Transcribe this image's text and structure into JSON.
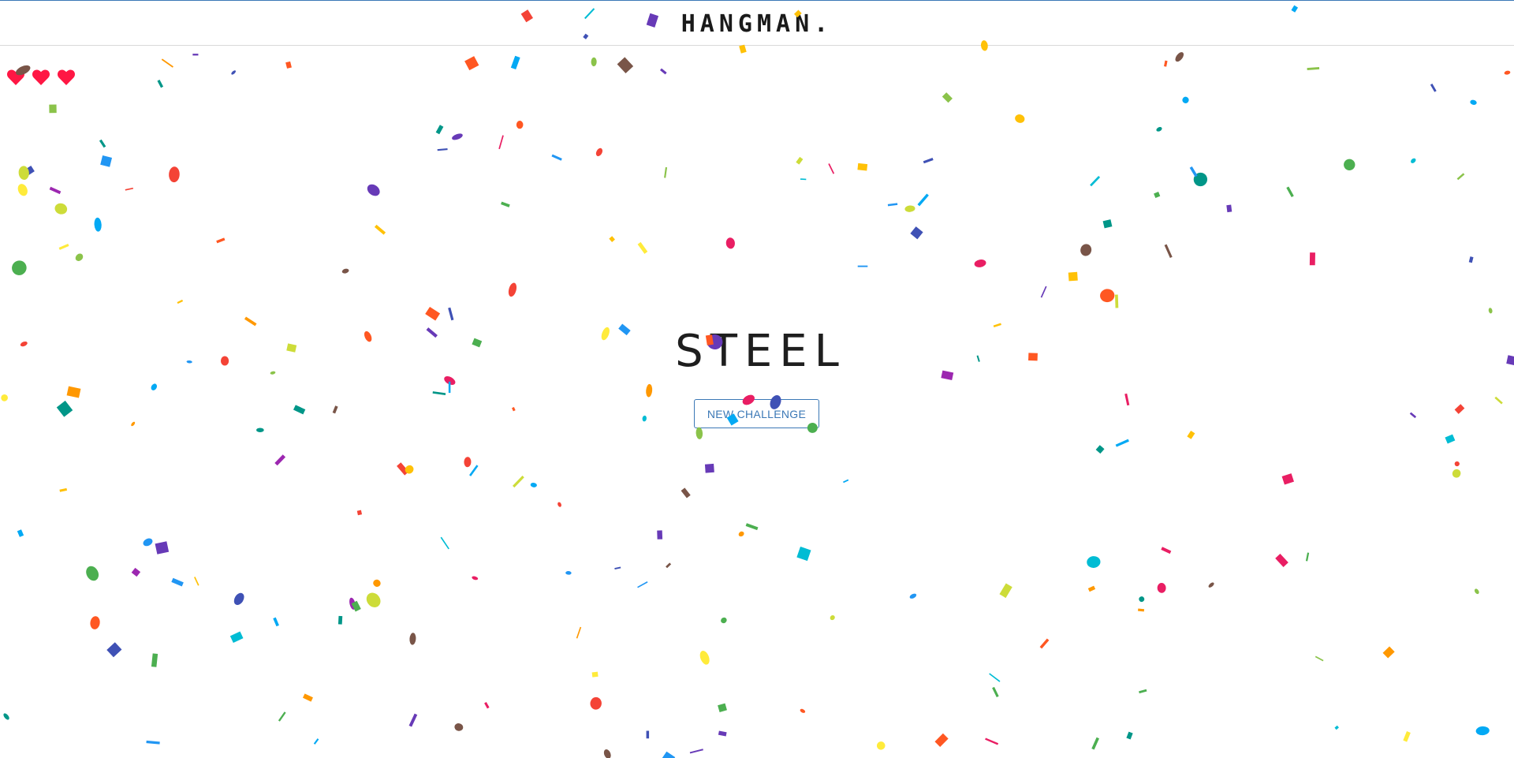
{
  "app": {
    "title": "HANGMAN."
  },
  "game": {
    "lives_remaining": 3,
    "heart_color": "#ff1744",
    "revealed_word": "STEEL",
    "result": "won"
  },
  "actions": {
    "new_challenge_label": "NEW CHALLENGE"
  },
  "theme": {
    "accent": "#3b78b6",
    "text": "#1e1e1e"
  },
  "confetti": {
    "palette": [
      "#f44336",
      "#e91e63",
      "#9c27b0",
      "#673ab7",
      "#3f51b5",
      "#2196f3",
      "#03a9f4",
      "#00bcd4",
      "#009688",
      "#4caf50",
      "#8bc34a",
      "#cddc39",
      "#ffeb3b",
      "#ffc107",
      "#ff9800",
      "#ff5722",
      "#795548"
    ]
  }
}
